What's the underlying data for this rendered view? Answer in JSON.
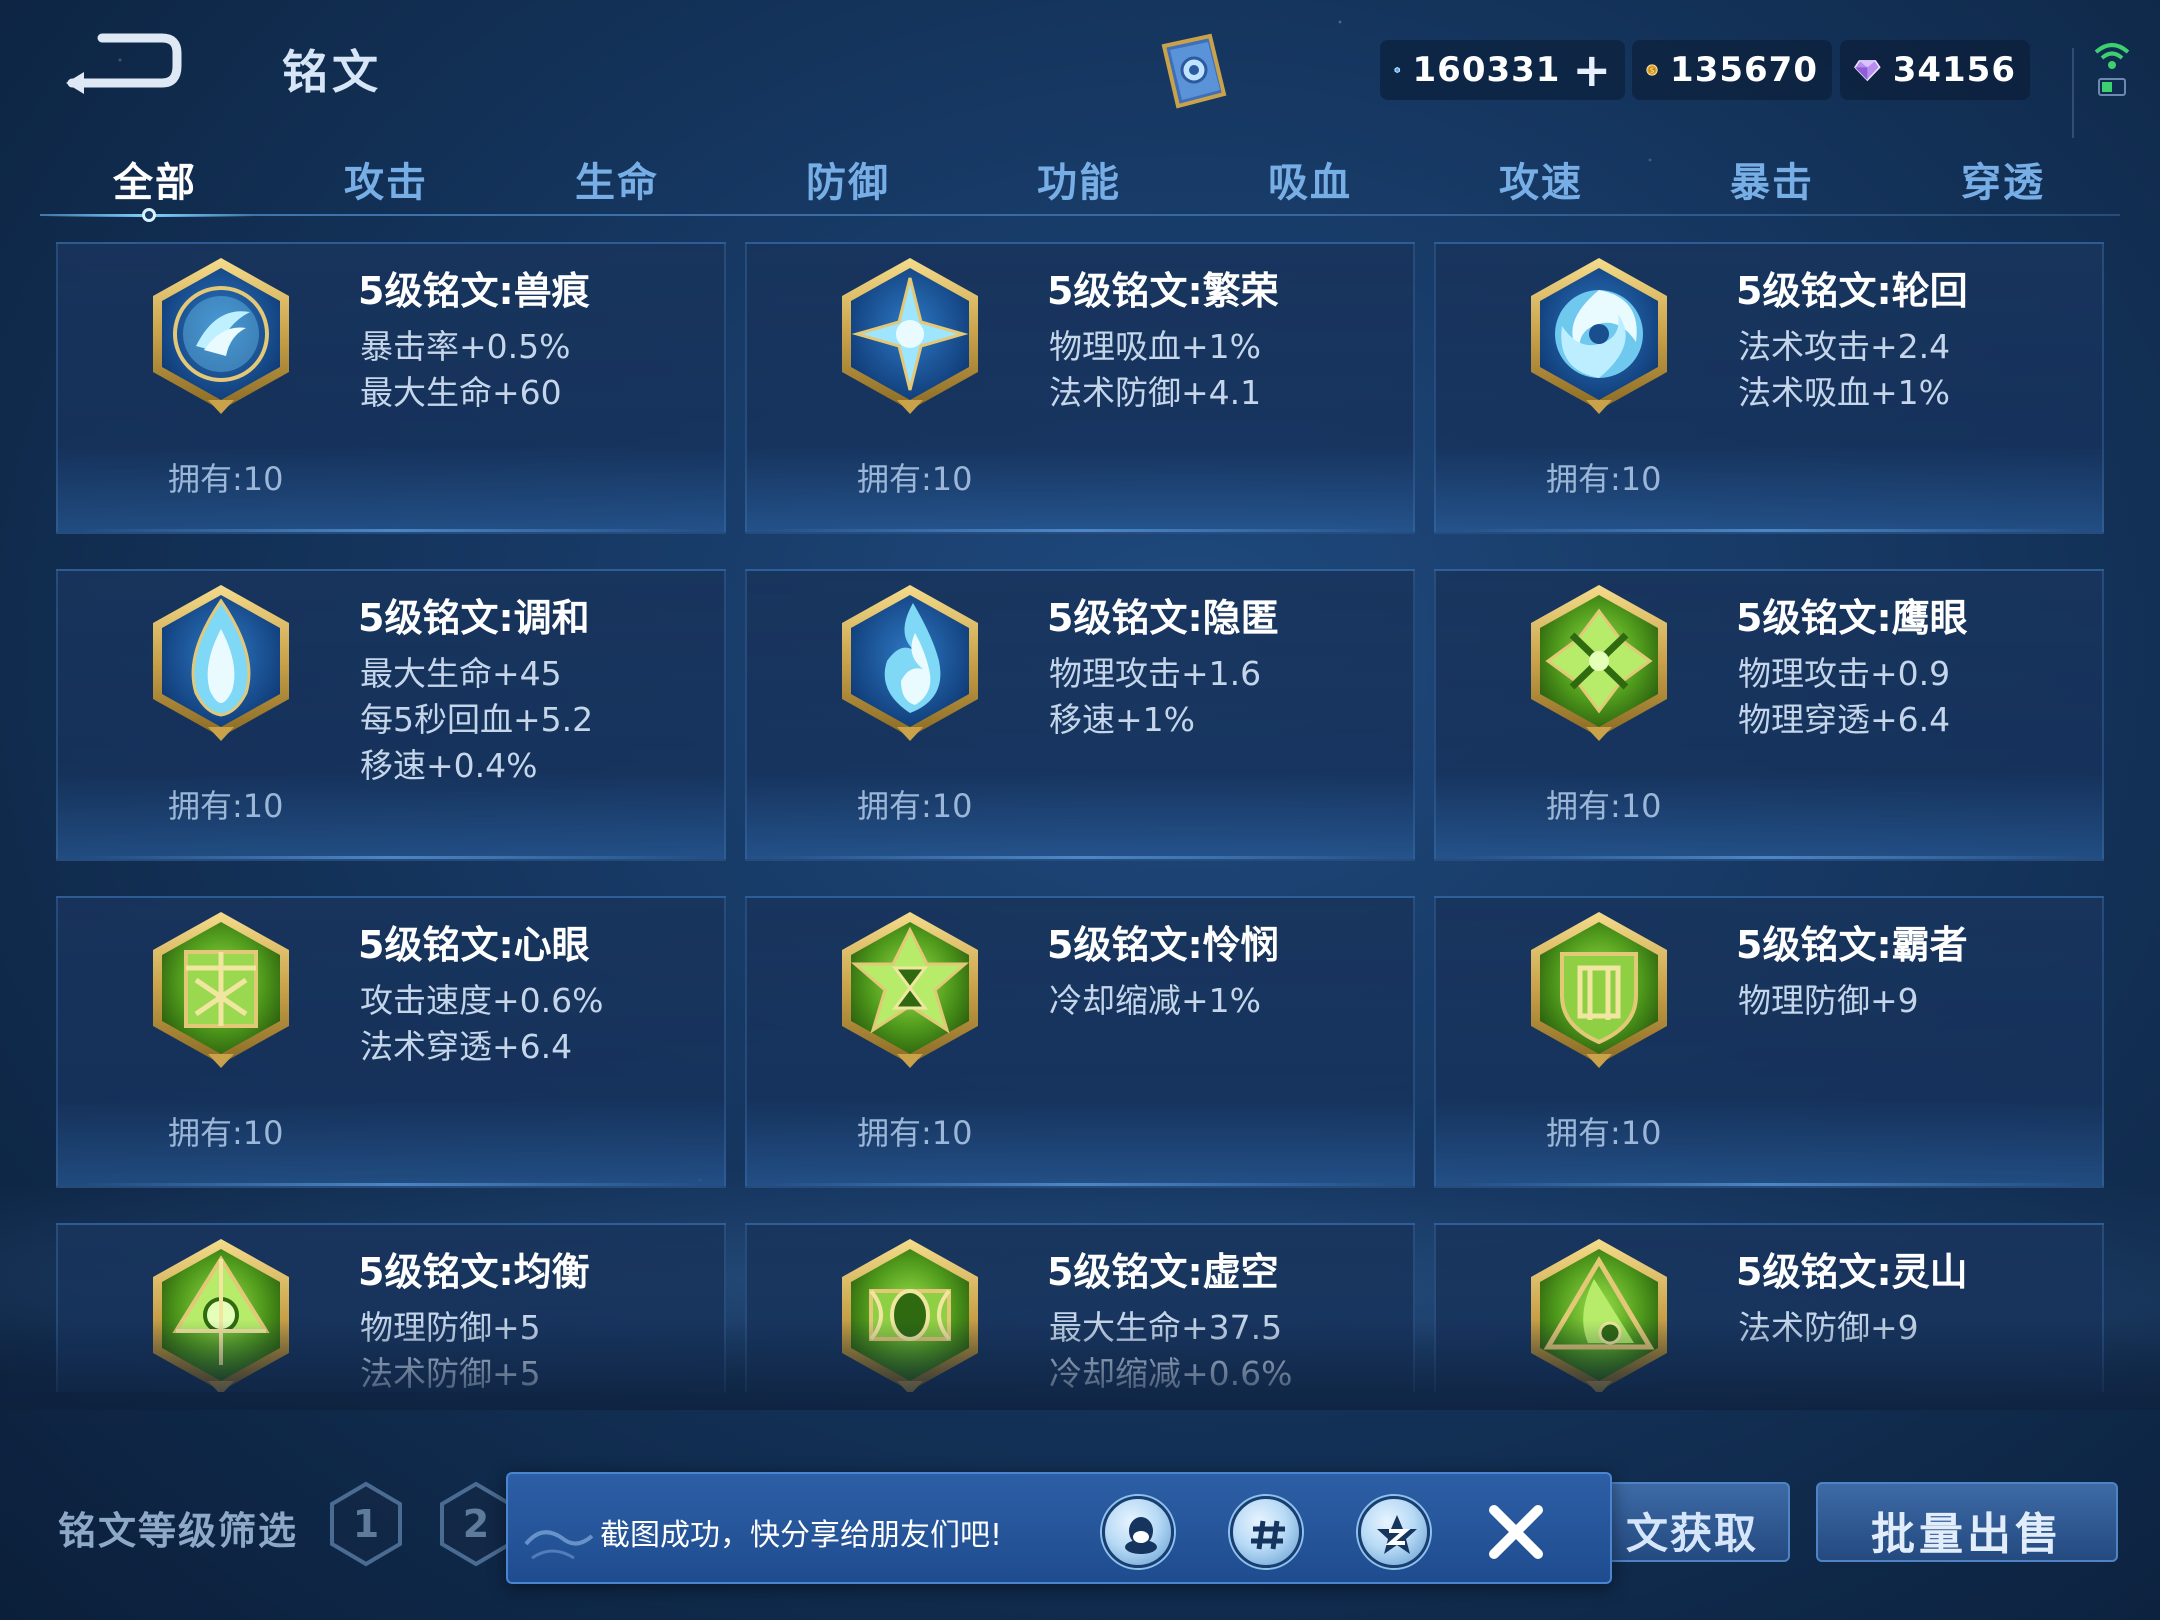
{
  "header": {
    "title": "铭文",
    "currencies": {
      "coupon": "160331",
      "gold": "135670",
      "diamond": "34156"
    }
  },
  "tabs": [
    {
      "label": "全部",
      "active": true
    },
    {
      "label": "攻击"
    },
    {
      "label": "生命"
    },
    {
      "label": "防御"
    },
    {
      "label": "功能"
    },
    {
      "label": "吸血"
    },
    {
      "label": "攻速"
    },
    {
      "label": "暴击"
    },
    {
      "label": "穿透"
    }
  ],
  "inscriptions": [
    {
      "name": "5级铭文:兽痕",
      "stats": [
        "暴击率+0.5%",
        "最大生命+60"
      ],
      "owned": "拥有:10",
      "color": "blue",
      "icon": "claw-emblem-icon"
    },
    {
      "name": "5级铭文:繁荣",
      "stats": [
        "物理吸血+1%",
        "法术防御+4.1"
      ],
      "owned": "拥有:10",
      "color": "blue",
      "icon": "star-emblem-icon"
    },
    {
      "name": "5级铭文:轮回",
      "stats": [
        "法术攻击+2.4",
        "法术吸血+1%"
      ],
      "owned": "拥有:10",
      "color": "blue",
      "icon": "swirl-emblem-icon"
    },
    {
      "name": "5级铭文:调和",
      "stats": [
        "最大生命+45",
        "每5秒回血+5.2",
        "移速+0.4%"
      ],
      "owned": "拥有:10",
      "color": "blue",
      "icon": "drop-emblem-icon"
    },
    {
      "name": "5级铭文:隐匿",
      "stats": [
        "物理攻击+1.6",
        "移速+1%"
      ],
      "owned": "拥有:10",
      "color": "blue",
      "icon": "flame-emblem-icon"
    },
    {
      "name": "5级铭文:鹰眼",
      "stats": [
        "物理攻击+0.9",
        "物理穿透+6.4"
      ],
      "owned": "拥有:10",
      "color": "green",
      "icon": "hawk-emblem-icon"
    },
    {
      "name": "5级铭文:心眼",
      "stats": [
        "攻击速度+0.6%",
        "法术穿透+6.4"
      ],
      "owned": "拥有:10",
      "color": "green",
      "icon": "eye-emblem-icon"
    },
    {
      "name": "5级铭文:怜悯",
      "stats": [
        "冷却缩减+1%"
      ],
      "owned": "拥有:10",
      "color": "green",
      "icon": "hourglass-emblem-icon"
    },
    {
      "name": "5级铭文:霸者",
      "stats": [
        "物理防御+9"
      ],
      "owned": "拥有:10",
      "color": "green",
      "icon": "shield-emblem-icon"
    },
    {
      "name": "5级铭文:均衡",
      "stats": [
        "物理防御+5",
        "法术防御+5"
      ],
      "owned": "",
      "color": "green",
      "icon": "balance-emblem-icon"
    },
    {
      "name": "5级铭文:虚空",
      "stats": [
        "最大生命+37.5",
        "冷却缩减+0.6%"
      ],
      "owned": "",
      "color": "green",
      "icon": "void-emblem-icon"
    },
    {
      "name": "5级铭文:灵山",
      "stats": [
        "法术防御+9"
      ],
      "owned": "",
      "color": "green",
      "icon": "mountain-emblem-icon"
    }
  ],
  "bottom": {
    "filter_label": "铭文等级筛选",
    "levels": [
      "1",
      "2"
    ],
    "obtain_label": "文获取",
    "sell_label": "批量出售"
  },
  "toast": {
    "message": "截图成功，快分享给朋友们吧!",
    "share_icons": [
      "qq-icon",
      "wechat-icon",
      "qzone-icon"
    ]
  },
  "colors": {
    "blue_gem": "#7fd8f5",
    "green_gem": "#6fbf2c",
    "gold_frame": "#c9a24a",
    "accent": "#7fd3ff"
  }
}
